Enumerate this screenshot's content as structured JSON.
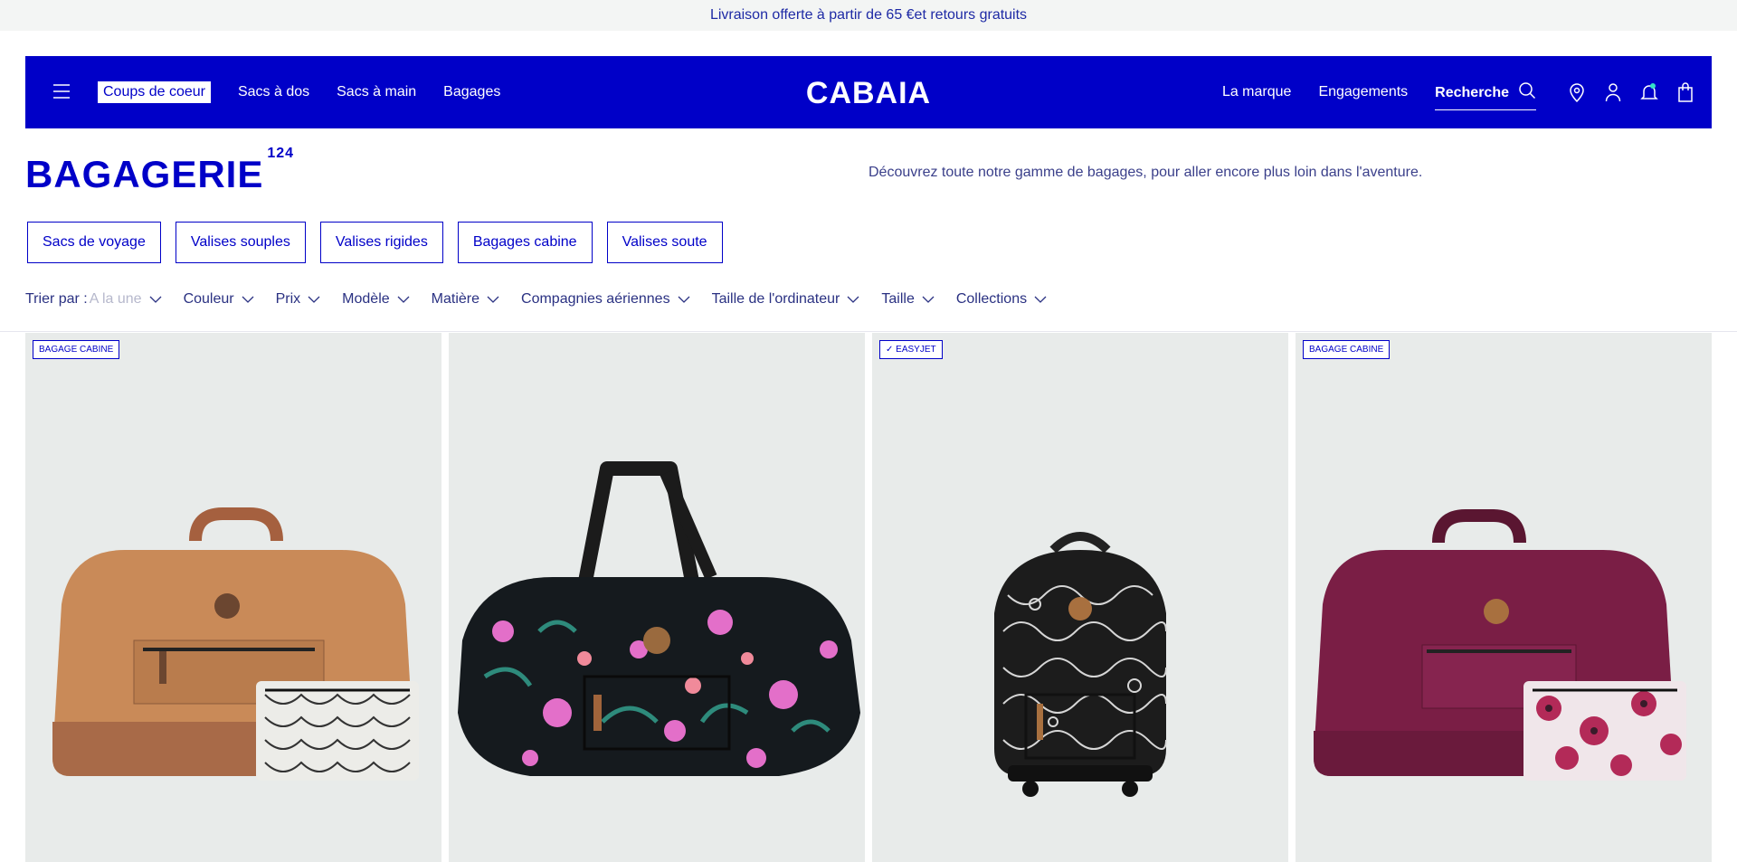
{
  "promo_bar": {
    "text": "Livraison offerte à partir de 65 €et retours gratuits"
  },
  "nav": {
    "logo": "CABAIA",
    "left_links": [
      "Coups de coeur",
      "Sacs à dos",
      "Sacs à main",
      "Bagages"
    ],
    "right_links": [
      "La marque",
      "Engagements"
    ],
    "search_label": "Recherche",
    "icons": [
      "menu-icon",
      "search-icon",
      "store-locator-icon",
      "account-icon",
      "notification-bell-icon",
      "cart-icon"
    ]
  },
  "page": {
    "title": "BAGAGERIE",
    "count": "124",
    "description": "Découvrez toute notre gamme de bagages, pour aller encore plus loin dans l'aventure."
  },
  "categories": [
    "Sacs de voyage",
    "Valises souples",
    "Valises rigides",
    "Bagages cabine",
    "Valises soute"
  ],
  "filters": {
    "sort_label": "Trier par :",
    "sort_value": "A la une",
    "items": [
      "Couleur",
      "Prix",
      "Modèle",
      "Matière",
      "Compagnies aériennes",
      "Taille de l'ordinateur",
      "Taille",
      "Collections"
    ]
  },
  "products": [
    {
      "badge": "BAGAGE CABINE"
    },
    {
      "badge": ""
    },
    {
      "badge": "✓ EASYJET"
    },
    {
      "badge": "BAGAGE CABINE"
    }
  ],
  "colors": {
    "brand_blue": "#0000c8",
    "card_bg": "#e8ebea",
    "promo_bg": "#f3f5f4"
  }
}
